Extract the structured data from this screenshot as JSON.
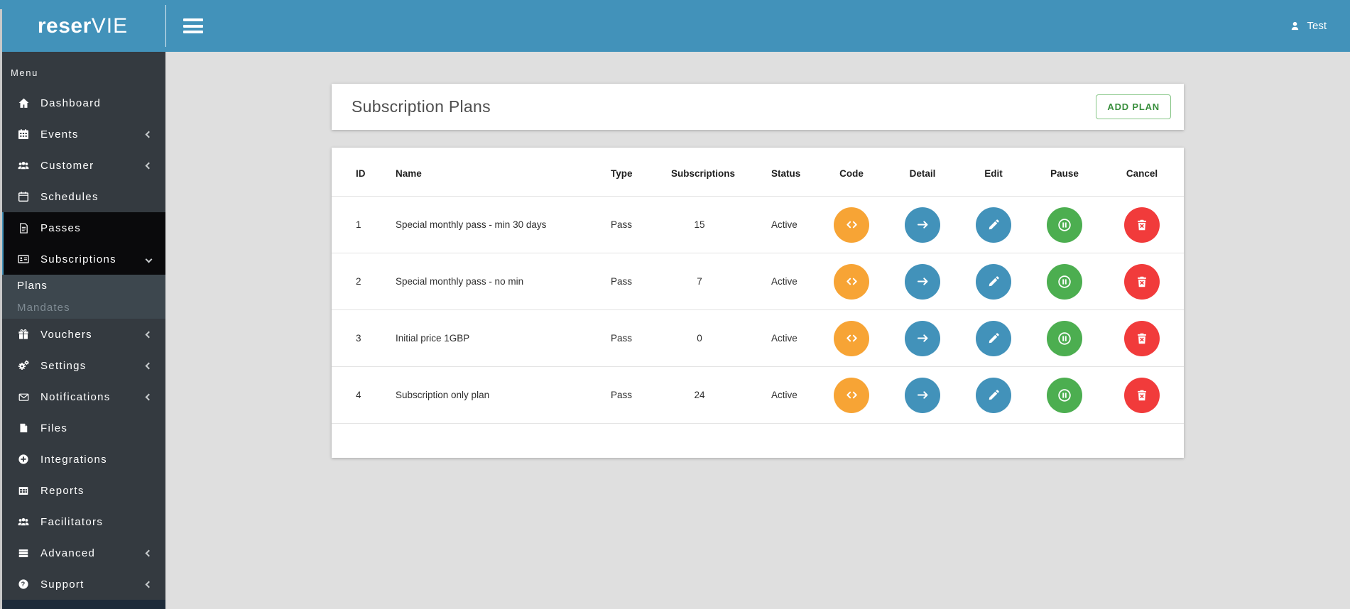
{
  "topbar": {
    "logo_bold": "reser",
    "logo_thin": "VIE",
    "user_label": "Test"
  },
  "sidebar": {
    "menu_label": "Menu",
    "items_top": [
      {
        "label": "Dashboard",
        "icon": "home-icon",
        "chevron": null
      },
      {
        "label": "Events",
        "icon": "calendar-icon",
        "chevron": "left"
      },
      {
        "label": "Customer",
        "icon": "users-icon",
        "chevron": "left"
      },
      {
        "label": "Schedules",
        "icon": "calendar-outline-icon",
        "chevron": null
      }
    ],
    "items_active": [
      {
        "label": "Passes",
        "icon": "file-text-icon",
        "chevron": null
      },
      {
        "label": "Subscriptions",
        "icon": "id-card-icon",
        "chevron": "down"
      }
    ],
    "submenu": [
      {
        "label": "Plans",
        "state": "active"
      },
      {
        "label": "Mandates",
        "state": "muted"
      }
    ],
    "items_bottom": [
      {
        "label": "Vouchers",
        "icon": "gift-icon",
        "chevron": "left"
      },
      {
        "label": "Settings",
        "icon": "cogs-icon",
        "chevron": "left"
      },
      {
        "label": "Notifications",
        "icon": "envelope-icon",
        "chevron": "left"
      },
      {
        "label": "Files",
        "icon": "file-icon",
        "chevron": null
      },
      {
        "label": "Integrations",
        "icon": "plus-circle-icon",
        "chevron": null
      },
      {
        "label": "Reports",
        "icon": "table-icon",
        "chevron": null
      },
      {
        "label": "Facilitators",
        "icon": "users-icon",
        "chevron": null
      },
      {
        "label": "Advanced",
        "icon": "list-icon",
        "chevron": "left"
      },
      {
        "label": "Support",
        "icon": "question-circle-icon",
        "chevron": "left"
      }
    ]
  },
  "header": {
    "title": "Subscription Plans",
    "add_button_label": "ADD PLAN"
  },
  "table": {
    "columns": [
      "ID",
      "Name",
      "Type",
      "Subscriptions",
      "Status",
      "Code",
      "Detail",
      "Edit",
      "Pause",
      "Cancel"
    ],
    "rows": [
      {
        "id": "1",
        "name": "Special monthly pass - min 30 days",
        "type": "Pass",
        "subscriptions": "15",
        "status": "Active"
      },
      {
        "id": "2",
        "name": "Special monthly pass - no min",
        "type": "Pass",
        "subscriptions": "7",
        "status": "Active"
      },
      {
        "id": "3",
        "name": "Initial price 1GBP",
        "type": "Pass",
        "subscriptions": "0",
        "status": "Active"
      },
      {
        "id": "4",
        "name": "Subscription only plan",
        "type": "Pass",
        "subscriptions": "24",
        "status": "Active"
      }
    ],
    "action_icons": [
      "code-icon",
      "arrow-right-icon",
      "pencil-icon",
      "pause-circle-icon",
      "trash-icon"
    ]
  },
  "colors": {
    "topbar_blue": "#4292ba",
    "sidebar_dark": "#343a40",
    "active_item_bg": "#0a0a0c",
    "submenu_bg": "#3d474e",
    "code_orange": "#f7a435",
    "action_blue": "#4292ba",
    "pause_green": "#4cae50",
    "cancel_red": "#f13b3b",
    "add_button_green": "#388e3c"
  }
}
